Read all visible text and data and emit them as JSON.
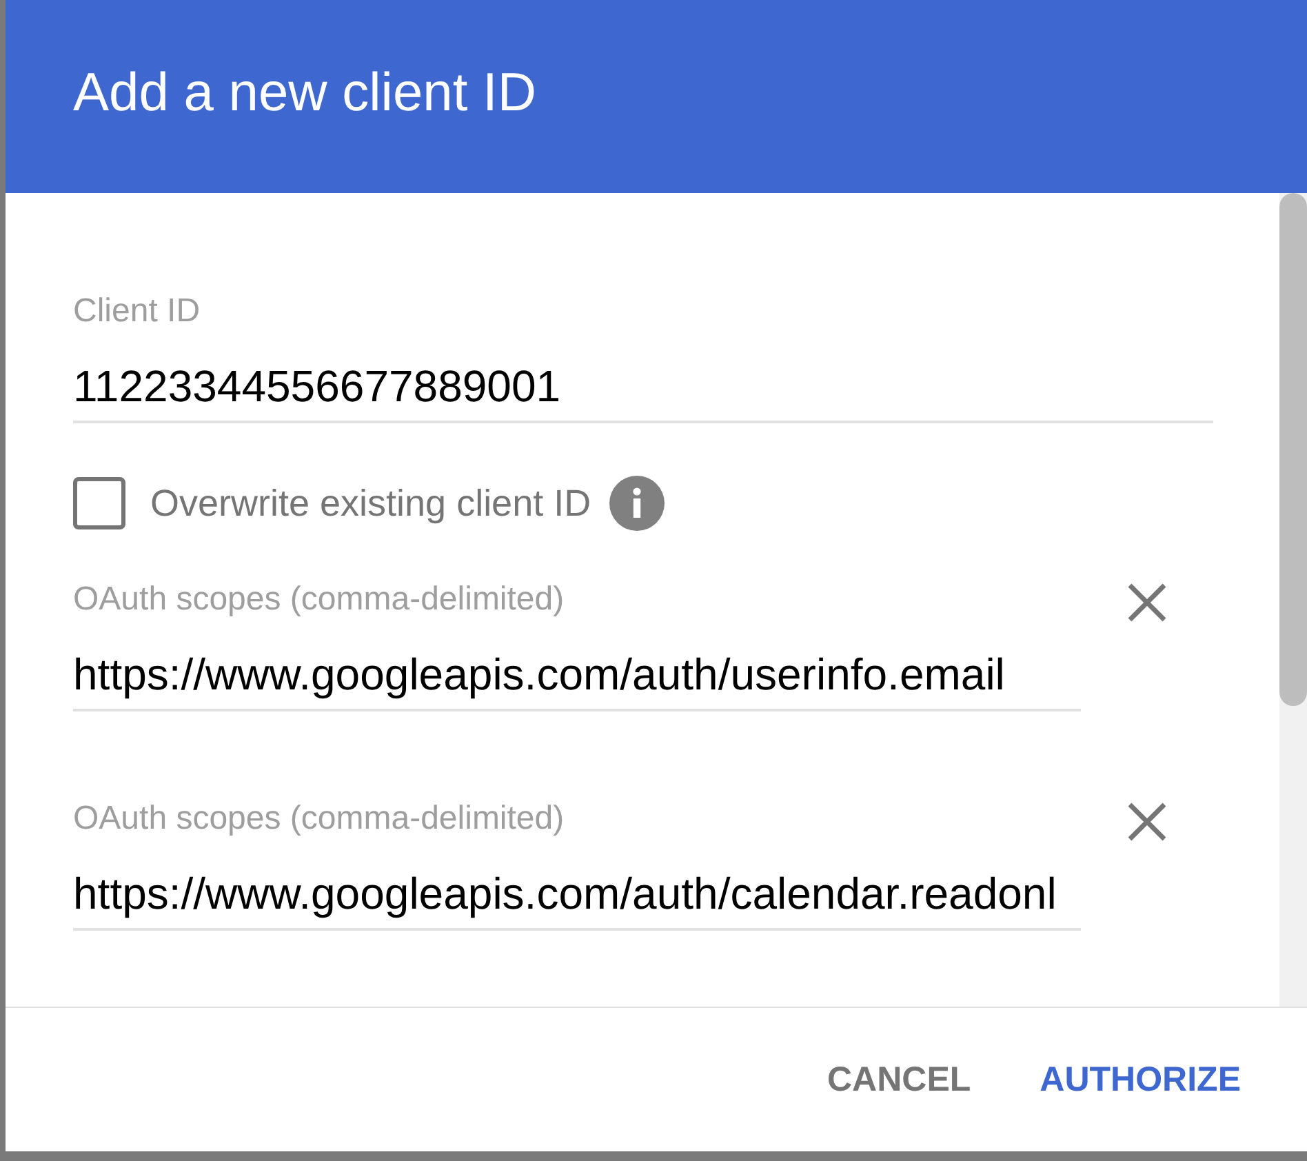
{
  "dialog": {
    "title": "Add a new client ID"
  },
  "client_id": {
    "label": "Client ID",
    "value": "11223344556677889001"
  },
  "overwrite": {
    "label": "Overwrite existing client ID",
    "checked": false
  },
  "scopes": [
    {
      "label": "OAuth scopes (comma-delimited)",
      "value": "https://www.googleapis.com/auth/userinfo.email"
    },
    {
      "label": "OAuth scopes (comma-delimited)",
      "value": "https://www.googleapis.com/auth/calendar.readonl"
    }
  ],
  "buttons": [
    {
      "label": "CANCEL",
      "kind": "cancel"
    },
    {
      "label": "AUTHORIZE",
      "kind": "confirm"
    }
  ]
}
